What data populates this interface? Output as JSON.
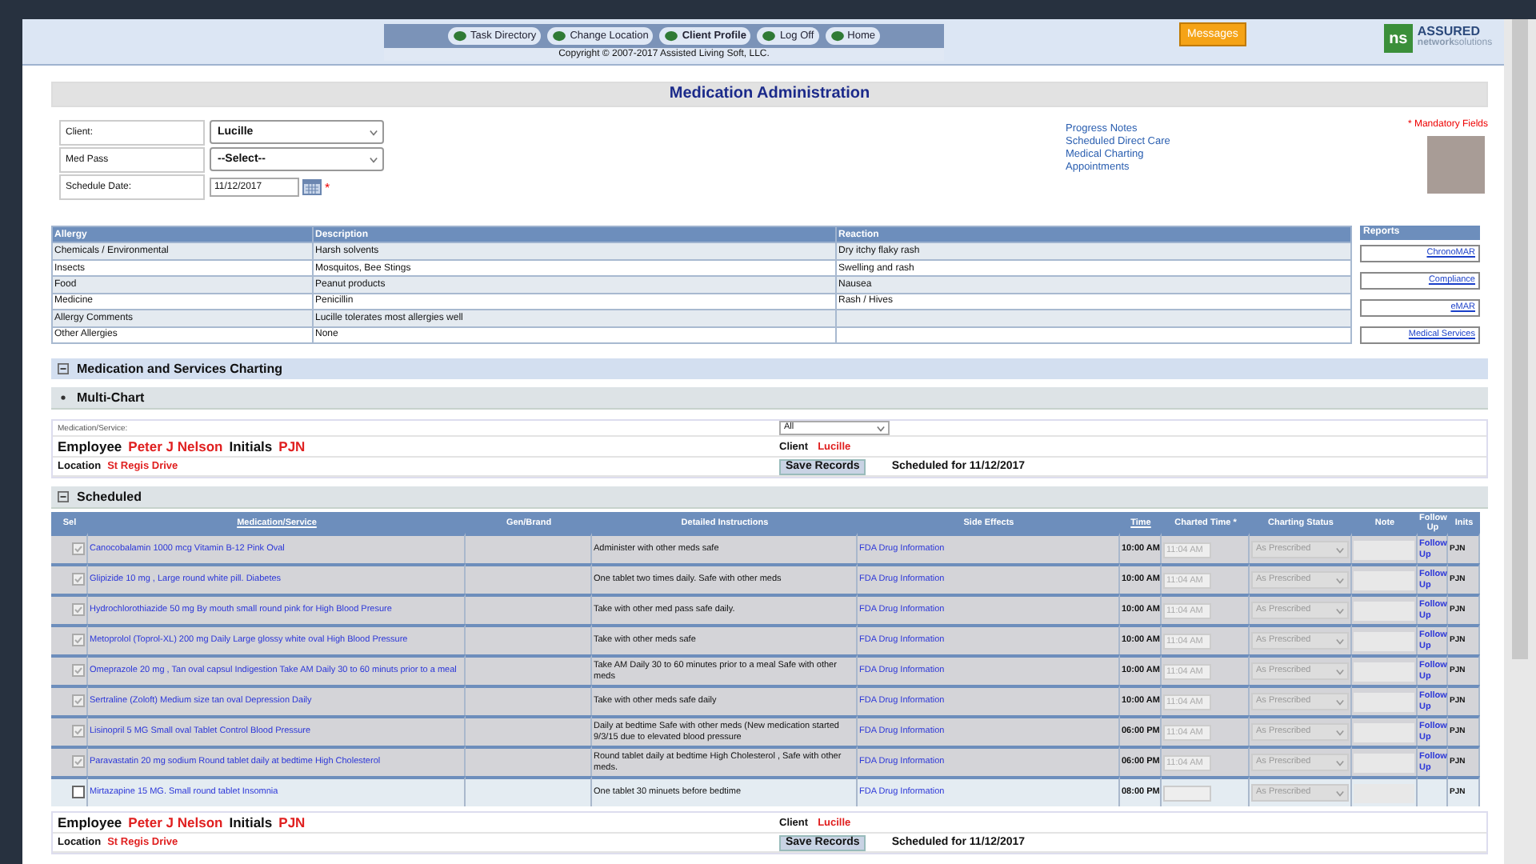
{
  "nav": {
    "buttons": [
      {
        "label": "Task Directory",
        "selected": false
      },
      {
        "label": "Change Location",
        "selected": false
      },
      {
        "label": "Client Profile",
        "selected": true
      },
      {
        "label": "Log Off",
        "selected": false
      },
      {
        "label": "Home",
        "selected": false
      }
    ],
    "copyright": "Copyright © 2007-2017 Assisted Living Soft, LLC.",
    "messages": "Messages",
    "logo": {
      "mark": "ns",
      "name": "ASSURED",
      "tagline": "**network**solutions"
    }
  },
  "page_title": "Medication Administration",
  "mandatory_note": "* Mandatory Fields",
  "form": {
    "client": {
      "label": "Client:",
      "value": "Lucille"
    },
    "med_pass": {
      "label": "Med Pass",
      "value": "--Select--"
    },
    "schedule_date": {
      "label": "Schedule Date:",
      "value": "11/12/2017",
      "required_mark": "*"
    }
  },
  "links": [
    "Progress Notes",
    "Scheduled Direct Care",
    "Medical Charting",
    "Appointments"
  ],
  "allergies": {
    "columns": [
      "Allergy",
      "Description",
      "Reaction"
    ],
    "rows": [
      [
        "Chemicals / Environmental",
        "Harsh solvents",
        "Dry itchy flaky rash"
      ],
      [
        "Insects",
        "Mosquitos, Bee Stings",
        "Swelling and rash"
      ],
      [
        "Food",
        "Peanut products",
        "Nausea"
      ],
      [
        "Medicine",
        "Penicillin",
        "Rash / Hives"
      ],
      [
        "Allergy Comments",
        "Lucille tolerates most allergies well",
        ""
      ],
      [
        "Other Allergies",
        "None",
        ""
      ]
    ]
  },
  "reports": {
    "title": "Reports",
    "items": [
      "ChronoMAR",
      "Compliance",
      "eMAR",
      "Medical Services"
    ]
  },
  "charting": {
    "title": "Medication and Services Charting",
    "expanded": true
  },
  "multi_chart": {
    "title": "Multi-Chart",
    "expanded": false
  },
  "filter": {
    "label": "Medication/Service:",
    "value": "All"
  },
  "record_bars": [
    {
      "employee_label": "Employee",
      "employee": "Peter J Nelson",
      "initials_label": "Initials",
      "initials": "PJN",
      "client_label": "Client",
      "client": "Lucille",
      "location_label": "Location",
      "location": "St Regis Drive",
      "save": "Save Records",
      "scheduled_for": "Scheduled for 11/12/2017"
    },
    {
      "employee_label": "Employee",
      "employee": "Peter J Nelson",
      "initials_label": "Initials",
      "initials": "PJN",
      "client_label": "Client",
      "client": "Lucille",
      "location_label": "Location",
      "location": "St Regis Drive",
      "save": "Save Records",
      "scheduled_for": "Scheduled for 11/12/2017"
    }
  ],
  "scheduled": {
    "title": "Scheduled",
    "expanded": true,
    "columns": [
      {
        "label": "Sel",
        "link": false
      },
      {
        "label": "Medication/Service",
        "link": true
      },
      {
        "label": "Gen/Brand",
        "link": false
      },
      {
        "label": "Detailed Instructions",
        "link": false
      },
      {
        "label": "Side Effects",
        "link": false
      },
      {
        "label": "Time",
        "link": true
      },
      {
        "label": "Charted Time *",
        "link": false
      },
      {
        "label": "Charting Status",
        "link": false
      },
      {
        "label": "Note",
        "link": false
      },
      {
        "label": "Follow Up",
        "link": false
      },
      {
        "label": "Inits",
        "link": false
      }
    ],
    "rows": [
      {
        "checked": true,
        "name": "Canocobalamin 1000 mcg Vitamin B-12 Pink Oval",
        "instructions": "Administer with other meds safe",
        "side_effects": "FDA Drug Information",
        "time": "10:00 AM",
        "charted_time": "11:04 AM",
        "status": "As Prescribed",
        "follow_up": "Follow Up",
        "initials": "PJN"
      },
      {
        "checked": true,
        "name": "Glipizide 10 mg , Large round white pill. Diabetes",
        "instructions": "One tablet two times daily. Safe with other meds",
        "side_effects": "FDA Drug Information",
        "time": "10:00 AM",
        "charted_time": "11:04 AM",
        "status": "As Prescribed",
        "follow_up": "Follow Up",
        "initials": "PJN"
      },
      {
        "checked": true,
        "name": "Hydrochlorothiazide 50 mg By mouth small round pink for High Blood Presure",
        "instructions": "Take with other med pass safe daily.",
        "side_effects": "FDA Drug Information",
        "time": "10:00 AM",
        "charted_time": "11:04 AM",
        "status": "As Prescribed",
        "follow_up": "Follow Up",
        "initials": "PJN"
      },
      {
        "checked": true,
        "name": "Metoprolol (Toprol-XL) 200 mg Daily Large glossy white oval High Blood Pressure",
        "instructions": "Take with other meds safe",
        "side_effects": "FDA Drug Information",
        "time": "10:00 AM",
        "charted_time": "11:04 AM",
        "status": "As Prescribed",
        "follow_up": "Follow Up",
        "initials": "PJN"
      },
      {
        "checked": true,
        "name": "Omeprazole 20 mg , Tan oval capsul Indigestion Take AM Daily 30 to 60 minuts prior to a meal",
        "instructions": "Take AM Daily 30 to 60 minutes prior to a meal Safe with other meds",
        "side_effects": "FDA Drug Information",
        "time": "10:00 AM",
        "charted_time": "11:04 AM",
        "status": "As Prescribed",
        "follow_up": "Follow Up",
        "initials": "PJN"
      },
      {
        "checked": true,
        "name": "Sertraline (Zoloft) Medium size tan oval Depression Daily",
        "instructions": "Take with other meds safe daily",
        "side_effects": "FDA Drug Information",
        "time": "10:00 AM",
        "charted_time": "11:04 AM",
        "status": "As Prescribed",
        "follow_up": "Follow Up",
        "initials": "PJN"
      },
      {
        "checked": true,
        "name": "Lisinopril 5 MG Small oval Tablet Control Blood Pressure",
        "instructions": "Daily at bedtime Safe with other meds (New medication started 9/3/15 due to elevated blood pressure",
        "side_effects": "FDA Drug Information",
        "time": "06:00 PM",
        "charted_time": "11:04 AM",
        "status": "As Prescribed",
        "follow_up": "Follow Up",
        "initials": "PJN"
      },
      {
        "checked": true,
        "name": "Paravastatin 20 mg sodium Round tablet daily at bedtime High Cholesterol",
        "instructions": "Round tablet daily at bedtime High Cholesterol , Safe with other meds.",
        "side_effects": "FDA Drug Information",
        "time": "06:00 PM",
        "charted_time": "11:04 AM",
        "status": "As Prescribed",
        "follow_up": "Follow Up",
        "initials": "PJN"
      },
      {
        "checked": false,
        "name": "Mirtazapine 15 MG. Small round tablet Insomnia",
        "instructions": "One tablet 30 minuets before bedtime",
        "side_effects": "FDA Drug Information",
        "time": "08:00 PM",
        "status": "As Prescribed",
        "initials": "PJN"
      }
    ]
  }
}
